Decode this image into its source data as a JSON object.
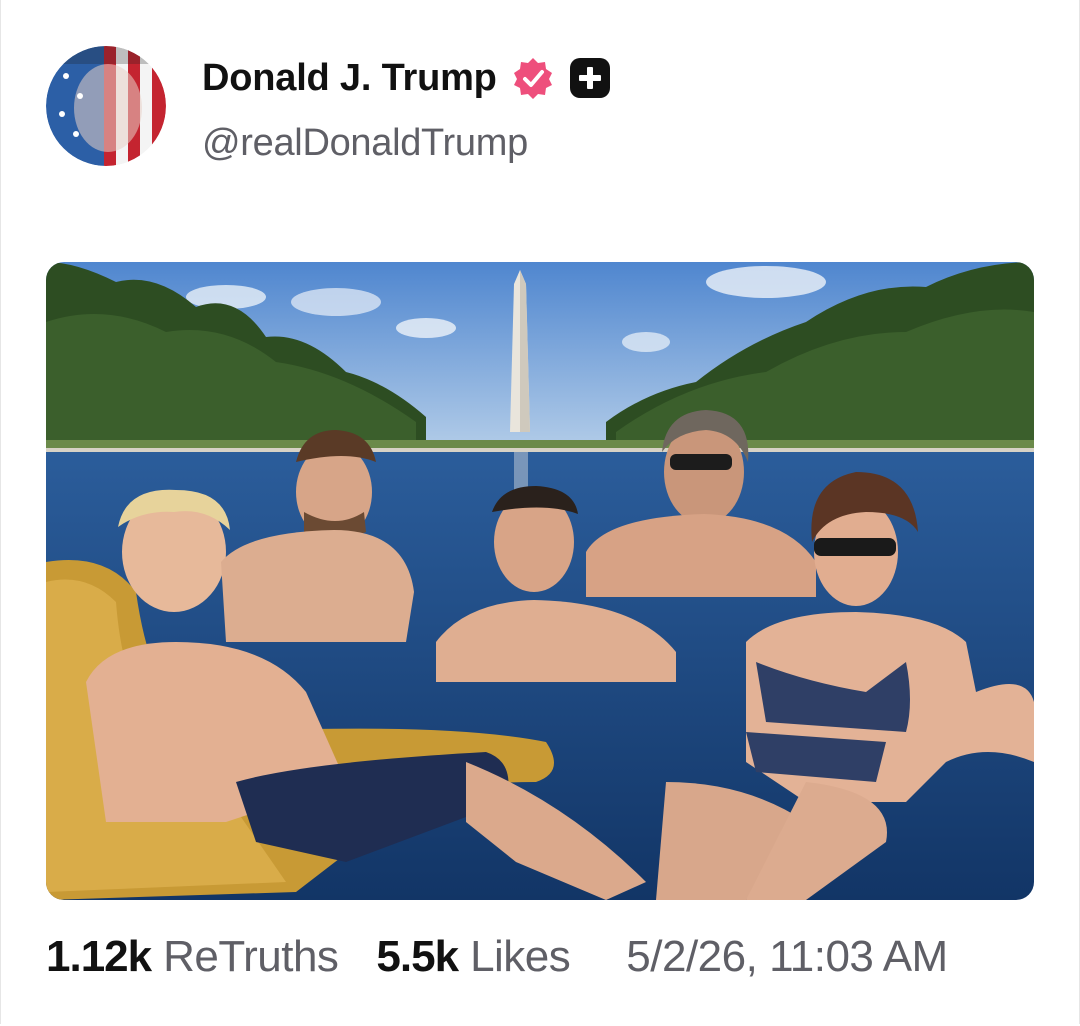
{
  "post": {
    "author": {
      "display_name": "Donald J. Trump",
      "handle": "@realDonaldTrump",
      "verified_icon": "verified-badge-icon",
      "extra_badge_icon": "plus-badge-icon"
    },
    "media": {
      "icon": "photo-image"
    },
    "stats": {
      "retruths_count": "1.12k",
      "retruths_label": "ReTruths",
      "likes_count": "5.5k",
      "likes_label": "Likes",
      "timestamp": "5/2/26, 11:03 AM"
    }
  },
  "colors": {
    "verified_badge": "#ee4f7c",
    "plus_badge": "#111111",
    "text_primary": "#111111",
    "text_secondary": "#5f5f66"
  }
}
